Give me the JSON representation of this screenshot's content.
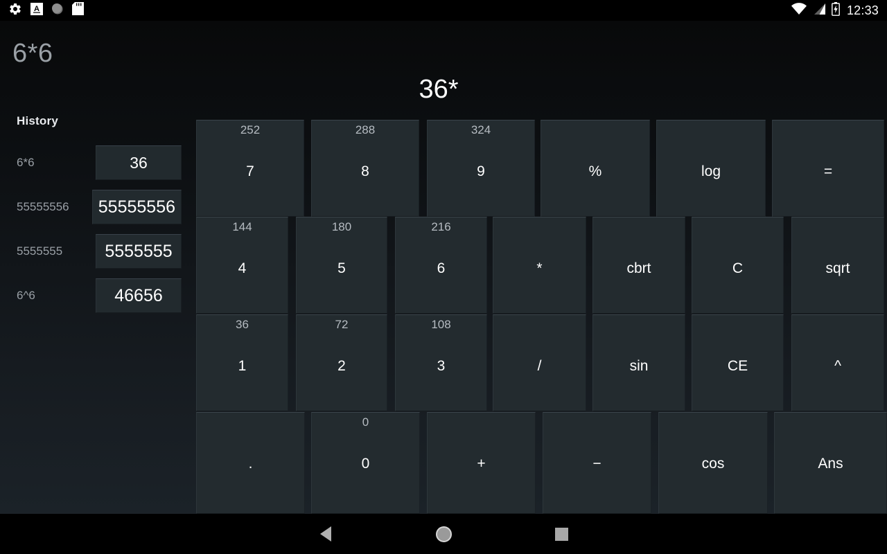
{
  "status_bar": {
    "icons": [
      "gear-icon",
      "font-size-a-icon",
      "circle-icon",
      "sd-card-icon"
    ],
    "wifi_icon": "wifi-icon",
    "signal_icon": "signal-icon",
    "battery_icon": "battery-charging-icon",
    "time": "12:33"
  },
  "app": {
    "expression": "6*6",
    "display": "36*"
  },
  "history": {
    "title": "History",
    "entries": [
      {
        "expression": "6*6",
        "result": "36",
        "size": "sz-md"
      },
      {
        "expression": "55555556",
        "result": "55555556",
        "size": "sz-lg"
      },
      {
        "expression": "5555555",
        "result": "5555555",
        "size": "sz-lg"
      },
      {
        "expression": "6^6",
        "result": "46656",
        "size": "sz-lg"
      }
    ]
  },
  "keypad": {
    "rows": [
      {
        "row": 1,
        "keys": [
          {
            "label": "7",
            "preview": "252",
            "type": "digit"
          },
          {
            "label": "8",
            "preview": "288",
            "type": "digit"
          },
          {
            "label": "9",
            "preview": "324",
            "type": "digit"
          },
          {
            "label": "%",
            "preview": "",
            "type": "operator"
          },
          {
            "label": "log",
            "preview": "",
            "type": "function"
          },
          {
            "label": "=",
            "preview": "",
            "type": "equals"
          }
        ]
      },
      {
        "row": 2,
        "keys": [
          {
            "label": "4",
            "preview": "144",
            "type": "digit"
          },
          {
            "label": "5",
            "preview": "180",
            "type": "digit"
          },
          {
            "label": "6",
            "preview": "216",
            "type": "digit"
          },
          {
            "label": "*",
            "preview": "",
            "type": "operator"
          },
          {
            "label": "cbrt",
            "preview": "",
            "type": "function"
          },
          {
            "label": "C",
            "preview": "",
            "type": "clear"
          },
          {
            "label": "sqrt",
            "preview": "",
            "type": "function"
          }
        ]
      },
      {
        "row": 3,
        "keys": [
          {
            "label": "1",
            "preview": "36",
            "type": "digit"
          },
          {
            "label": "2",
            "preview": "72",
            "type": "digit"
          },
          {
            "label": "3",
            "preview": "108",
            "type": "digit"
          },
          {
            "label": "/",
            "preview": "",
            "type": "operator"
          },
          {
            "label": "sin",
            "preview": "",
            "type": "function"
          },
          {
            "label": "CE",
            "preview": "",
            "type": "clear"
          },
          {
            "label": "^",
            "preview": "",
            "type": "operator"
          }
        ]
      },
      {
        "row": 4,
        "keys": [
          {
            "label": ".",
            "preview": "",
            "type": "decimal"
          },
          {
            "label": "0",
            "preview": "0",
            "type": "digit"
          },
          {
            "label": "+",
            "preview": "",
            "type": "operator"
          },
          {
            "label": "−",
            "preview": "",
            "type": "operator"
          },
          {
            "label": "cos",
            "preview": "",
            "type": "function"
          },
          {
            "label": "Ans",
            "preview": "",
            "type": "memory"
          }
        ]
      }
    ]
  },
  "nav_bar": {
    "back": "back-icon",
    "home": "home-icon",
    "recents": "recents-icon"
  },
  "colors": {
    "key_fill": "#232b2f",
    "background_top": "#08090a",
    "background_bottom": "#1b2228",
    "preview_text": "#b6bcc2",
    "label_text": "#ffffff",
    "muted_text": "#9aa0a6"
  }
}
